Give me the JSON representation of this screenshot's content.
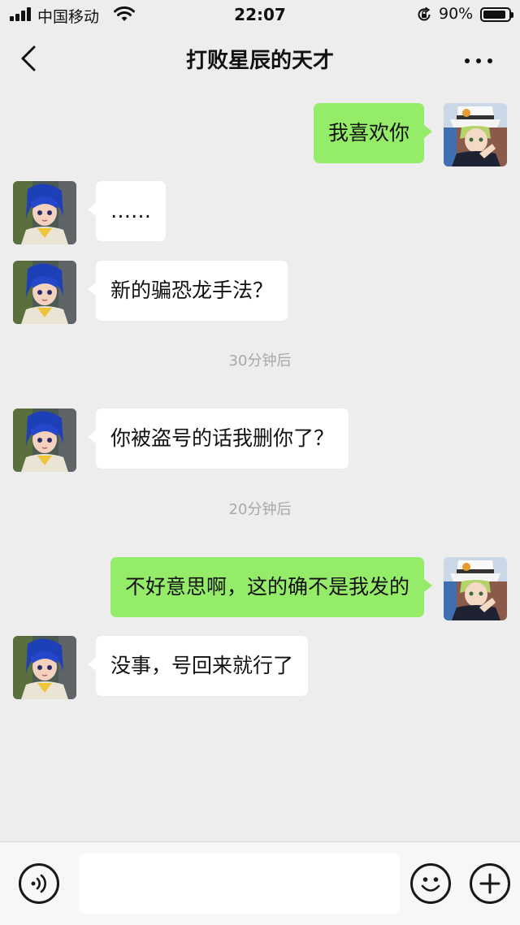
{
  "status_bar": {
    "carrier": "中国移动",
    "time": "22:07",
    "battery_percent": "90%",
    "battery_level": 0.9,
    "icons": [
      "signal-bars-icon",
      "wifi-icon",
      "rotation-lock-icon",
      "battery-icon"
    ]
  },
  "nav": {
    "title": "打败星辰的天才",
    "icons": [
      "back-chevron-icon",
      "more-dots-icon"
    ]
  },
  "messages": [
    {
      "side": "out",
      "text": "我喜欢你",
      "avatar": "self-avatar"
    },
    {
      "side": "in",
      "text": "……",
      "avatar": "contact-avatar"
    },
    {
      "side": "in",
      "text": "新的骗恐龙手法？",
      "avatar": "contact-avatar"
    },
    {
      "type": "time",
      "text": "30分钟后"
    },
    {
      "side": "in",
      "text": "你被盗号的话我删你了？",
      "avatar": "contact-avatar"
    },
    {
      "type": "time",
      "text": "20分钟后"
    },
    {
      "side": "out",
      "text": "不好意思啊，这的确不是我发的",
      "avatar": "self-avatar"
    },
    {
      "side": "in",
      "text": "没事，号回来就行了",
      "avatar": "contact-avatar"
    }
  ],
  "input_bar": {
    "text_value": "",
    "icons": [
      "voice-icon",
      "emoji-icon",
      "plus-icon"
    ]
  },
  "colors": {
    "background": "#ededed",
    "bubble_out": "#95ec69",
    "bubble_in": "#ffffff",
    "time_text": "#a8a8a8"
  }
}
